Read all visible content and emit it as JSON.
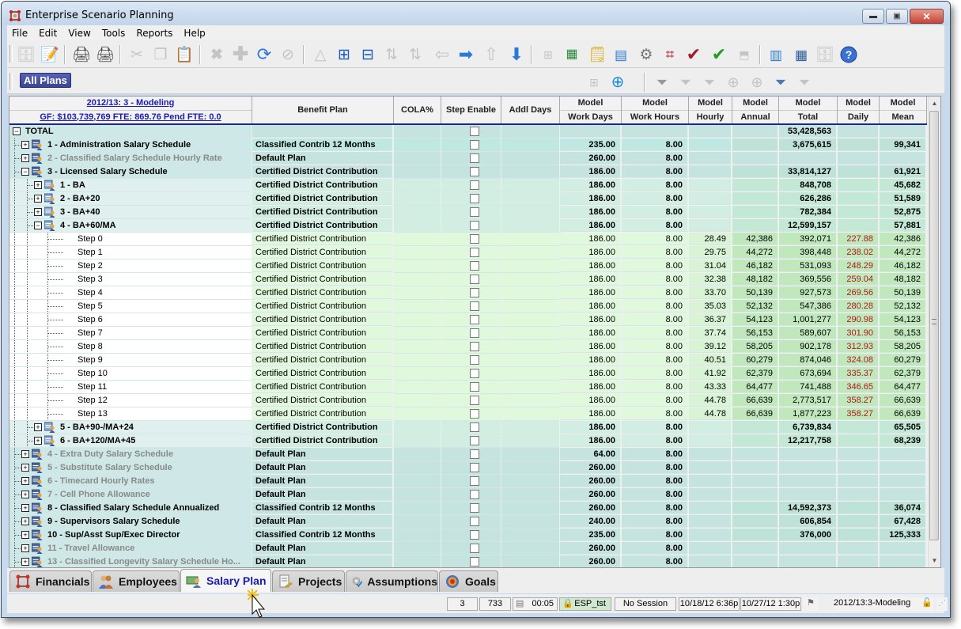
{
  "window": {
    "title": "Enterprise Scenario Planning",
    "controls": [
      "minimize",
      "maximize",
      "close"
    ]
  },
  "menu": [
    "File",
    "Edit",
    "View",
    "Tools",
    "Reports",
    "Help"
  ],
  "toolbar": {
    "main_icons": [
      "save-icon",
      "edit-icon",
      "print-icon",
      "print-preview-icon",
      "cut-icon",
      "copy-icon",
      "paste-icon",
      "delete-icon",
      "add-icon",
      "refresh-icon",
      "cancel-icon",
      "delta-icon",
      "expand-icon",
      "collapse-icon",
      "sort-asc-icon",
      "sort-desc-icon",
      "arrow-left-icon",
      "arrow-right-icon",
      "arrow-up-icon",
      "arrow-down-icon",
      "calculator-icon",
      "export-excel-icon",
      "add-note-icon",
      "grid-view-icon",
      "settings-window-icon",
      "model-window-icon",
      "check-red-icon",
      "check-green-icon",
      "upload-icon",
      "column-chooser-icon",
      "find-table-icon",
      "find-db-icon",
      "help-icon"
    ],
    "secondary_icons": [
      "calculator-icon",
      "target-icon",
      "filter-new-icon",
      "filter-edit-icon",
      "filter-remove-icon",
      "target-disabled-icon",
      "target-disabled2-icon",
      "filter-refresh-icon",
      "filter-save-icon"
    ],
    "all_plans_label": "All Plans"
  },
  "grid": {
    "header": {
      "scenario_link": "2012/13: 3 - Modeling",
      "summary_link": "GF: $103,739,769  FTE: 869.76  Pend FTE: 0.0",
      "columns": [
        {
          "l1": "",
          "l2": "Benefit Plan"
        },
        {
          "l1": "",
          "l2": "COLA%"
        },
        {
          "l1": "",
          "l2": "Step Enable"
        },
        {
          "l1": "",
          "l2": "Addl Days"
        },
        {
          "l1": "Model",
          "l2": "Work Days"
        },
        {
          "l1": "Model",
          "l2": "Work Hours"
        },
        {
          "l1": "Model",
          "l2": "Hourly"
        },
        {
          "l1": "Model",
          "l2": "Annual"
        },
        {
          "l1": "Model",
          "l2": "Total"
        },
        {
          "l1": "Model",
          "l2": "Daily"
        },
        {
          "l1": "Model",
          "l2": "Mean"
        }
      ]
    },
    "rows": [
      {
        "level": 0,
        "expander": "minus",
        "name": "TOTAL",
        "style": "bold",
        "plan": "",
        "work_days": "",
        "work_hours": "",
        "hourly": "",
        "annual": "",
        "total": "53,428,563",
        "daily": "",
        "mean": ""
      },
      {
        "level": 1,
        "expander": "plus",
        "name": "1 - Administration Salary Schedule",
        "style": "bold",
        "plan": "Classified Contrib 12 Months",
        "work_days": "235.00",
        "work_hours": "8.00",
        "hourly": "",
        "annual": "",
        "total": "3,675,615",
        "daily": "",
        "mean": "99,341"
      },
      {
        "level": 1,
        "expander": "plus",
        "name": "2 - Classified Salary Schedule Hourly Rate",
        "style": "grey",
        "plan": "Default Plan",
        "work_days": "260.00",
        "work_hours": "8.00",
        "hourly": "",
        "annual": "",
        "total": "",
        "daily": "",
        "mean": ""
      },
      {
        "level": 1,
        "expander": "minus",
        "name": "3 - Licensed Salary Schedule",
        "style": "bold",
        "plan": "Certified District Contribution",
        "work_days": "186.00",
        "work_hours": "8.00",
        "hourly": "",
        "annual": "",
        "total": "33,814,127",
        "daily": "",
        "mean": "61,921"
      },
      {
        "level": 2,
        "expander": "plus",
        "name": "1 - BA",
        "style": "bold",
        "plan": "Certified District Contribution",
        "work_days": "186.00",
        "work_hours": "8.00",
        "hourly": "",
        "annual": "",
        "total": "848,708",
        "daily": "",
        "mean": "45,682"
      },
      {
        "level": 2,
        "expander": "plus",
        "name": "2 - BA+20",
        "style": "bold",
        "plan": "Certified District Contribution",
        "work_days": "186.00",
        "work_hours": "8.00",
        "hourly": "",
        "annual": "",
        "total": "626,286",
        "daily": "",
        "mean": "51,589"
      },
      {
        "level": 2,
        "expander": "plus",
        "name": "3 - BA+40",
        "style": "bold",
        "plan": "Certified District Contribution",
        "work_days": "186.00",
        "work_hours": "8.00",
        "hourly": "",
        "annual": "",
        "total": "782,384",
        "daily": "",
        "mean": "52,875"
      },
      {
        "level": 2,
        "expander": "minus",
        "name": "4 - BA+60/MA",
        "style": "bold",
        "plan": "Certified District Contribution",
        "work_days": "186.00",
        "work_hours": "8.00",
        "hourly": "",
        "annual": "",
        "total": "12,599,157",
        "daily": "",
        "mean": "57,881"
      },
      {
        "level": 3,
        "expander": "",
        "name": "Step 0",
        "style": "step",
        "plan": "Certified District Contribution",
        "work_days": "186.00",
        "work_hours": "8.00",
        "hourly": "28.49",
        "annual": "42,386",
        "total": "392,071",
        "daily": "227.88",
        "mean": "42,386"
      },
      {
        "level": 3,
        "expander": "",
        "name": "Step 1",
        "style": "step",
        "plan": "Certified District Contribution",
        "work_days": "186.00",
        "work_hours": "8.00",
        "hourly": "29.75",
        "annual": "44,272",
        "total": "398,448",
        "daily": "238.02",
        "mean": "44,272"
      },
      {
        "level": 3,
        "expander": "",
        "name": "Step 2",
        "style": "step",
        "plan": "Certified District Contribution",
        "work_days": "186.00",
        "work_hours": "8.00",
        "hourly": "31.04",
        "annual": "46,182",
        "total": "531,093",
        "daily": "248.29",
        "mean": "46,182"
      },
      {
        "level": 3,
        "expander": "",
        "name": "Step 3",
        "style": "step",
        "plan": "Certified District Contribution",
        "work_days": "186.00",
        "work_hours": "8.00",
        "hourly": "32.38",
        "annual": "48,182",
        "total": "369,556",
        "daily": "259.04",
        "mean": "48,182"
      },
      {
        "level": 3,
        "expander": "",
        "name": "Step 4",
        "style": "step",
        "plan": "Certified District Contribution",
        "work_days": "186.00",
        "work_hours": "8.00",
        "hourly": "33.70",
        "annual": "50,139",
        "total": "927,573",
        "daily": "269.56",
        "mean": "50,139"
      },
      {
        "level": 3,
        "expander": "",
        "name": "Step 5",
        "style": "step",
        "plan": "Certified District Contribution",
        "work_days": "186.00",
        "work_hours": "8.00",
        "hourly": "35.03",
        "annual": "52,132",
        "total": "547,386",
        "daily": "280.28",
        "mean": "52,132"
      },
      {
        "level": 3,
        "expander": "",
        "name": "Step 6",
        "style": "step",
        "plan": "Certified District Contribution",
        "work_days": "186.00",
        "work_hours": "8.00",
        "hourly": "36.37",
        "annual": "54,123",
        "total": "1,001,277",
        "daily": "290.98",
        "mean": "54,123"
      },
      {
        "level": 3,
        "expander": "",
        "name": "Step 7",
        "style": "step",
        "plan": "Certified District Contribution",
        "work_days": "186.00",
        "work_hours": "8.00",
        "hourly": "37.74",
        "annual": "56,153",
        "total": "589,607",
        "daily": "301.90",
        "mean": "56,153"
      },
      {
        "level": 3,
        "expander": "",
        "name": "Step 8",
        "style": "step",
        "plan": "Certified District Contribution",
        "work_days": "186.00",
        "work_hours": "8.00",
        "hourly": "39.12",
        "annual": "58,205",
        "total": "902,178",
        "daily": "312.93",
        "mean": "58,205"
      },
      {
        "level": 3,
        "expander": "",
        "name": "Step 9",
        "style": "step",
        "plan": "Certified District Contribution",
        "work_days": "186.00",
        "work_hours": "8.00",
        "hourly": "40.51",
        "annual": "60,279",
        "total": "874,046",
        "daily": "324.08",
        "mean": "60,279"
      },
      {
        "level": 3,
        "expander": "",
        "name": "Step 10",
        "style": "step",
        "plan": "Certified District Contribution",
        "work_days": "186.00",
        "work_hours": "8.00",
        "hourly": "41.92",
        "annual": "62,379",
        "total": "673,694",
        "daily": "335.37",
        "mean": "62,379"
      },
      {
        "level": 3,
        "expander": "",
        "name": "Step 11",
        "style": "step",
        "plan": "Certified District Contribution",
        "work_days": "186.00",
        "work_hours": "8.00",
        "hourly": "43.33",
        "annual": "64,477",
        "total": "741,488",
        "daily": "346.65",
        "mean": "64,477"
      },
      {
        "level": 3,
        "expander": "",
        "name": "Step 12",
        "style": "step",
        "plan": "Certified District Contribution",
        "work_days": "186.00",
        "work_hours": "8.00",
        "hourly": "44.78",
        "annual": "66,639",
        "total": "2,773,517",
        "daily": "358.27",
        "mean": "66,639"
      },
      {
        "level": 3,
        "expander": "",
        "name": "Step 13",
        "style": "step",
        "plan": "Certified District Contribution",
        "work_days": "186.00",
        "work_hours": "8.00",
        "hourly": "44.78",
        "annual": "66,639",
        "total": "1,877,223",
        "daily": "358.27",
        "mean": "66,639"
      },
      {
        "level": 2,
        "expander": "plus",
        "name": "5 - BA+90-/MA+24",
        "style": "bold",
        "plan": "Certified District Contribution",
        "work_days": "186.00",
        "work_hours": "8.00",
        "hourly": "",
        "annual": "",
        "total": "6,739,834",
        "daily": "",
        "mean": "65,505"
      },
      {
        "level": 2,
        "expander": "plus",
        "name": "6 - BA+120/MA+45",
        "style": "bold",
        "plan": "Certified District Contribution",
        "work_days": "186.00",
        "work_hours": "8.00",
        "hourly": "",
        "annual": "",
        "total": "12,217,758",
        "daily": "",
        "mean": "68,239"
      },
      {
        "level": 1,
        "expander": "plus",
        "name": "4 - Extra Duty Salary Schedule",
        "style": "grey",
        "plan": "Default Plan",
        "work_days": "64.00",
        "work_hours": "8.00",
        "hourly": "",
        "annual": "",
        "total": "",
        "daily": "",
        "mean": ""
      },
      {
        "level": 1,
        "expander": "plus",
        "name": "5 - Substitute  Salary Schedule",
        "style": "grey",
        "plan": "Default Plan",
        "work_days": "260.00",
        "work_hours": "8.00",
        "hourly": "",
        "annual": "",
        "total": "",
        "daily": "",
        "mean": ""
      },
      {
        "level": 1,
        "expander": "plus",
        "name": "6 - Timecard Hourly Rates",
        "style": "grey",
        "plan": "Default Plan",
        "work_days": "260.00",
        "work_hours": "8.00",
        "hourly": "",
        "annual": "",
        "total": "",
        "daily": "",
        "mean": ""
      },
      {
        "level": 1,
        "expander": "plus",
        "name": "7 - Cell Phone Allowance",
        "style": "grey",
        "plan": "Default Plan",
        "work_days": "260.00",
        "work_hours": "8.00",
        "hourly": "",
        "annual": "",
        "total": "",
        "daily": "",
        "mean": ""
      },
      {
        "level": 1,
        "expander": "plus",
        "name": "8 - Classified Salary Schedule Annualized",
        "style": "bold",
        "plan": "Classified Contrib 12 Months",
        "work_days": "260.00",
        "work_hours": "8.00",
        "hourly": "",
        "annual": "",
        "total": "14,592,373",
        "daily": "",
        "mean": "36,074"
      },
      {
        "level": 1,
        "expander": "plus",
        "name": "9 - Supervisors Salary Schedule",
        "style": "bold",
        "plan": "Default Plan",
        "work_days": "240.00",
        "work_hours": "8.00",
        "hourly": "",
        "annual": "",
        "total": "606,854",
        "daily": "",
        "mean": "67,428"
      },
      {
        "level": 1,
        "expander": "plus",
        "name": "10 - Sup/Asst Sup/Exec Director",
        "style": "bold",
        "plan": "Classified Contrib 12 Months",
        "work_days": "235.00",
        "work_hours": "8.00",
        "hourly": "",
        "annual": "",
        "total": "376,000",
        "daily": "",
        "mean": "125,333"
      },
      {
        "level": 1,
        "expander": "plus",
        "name": "11 - Travel Allowance",
        "style": "grey",
        "plan": "Default Plan",
        "work_days": "260.00",
        "work_hours": "8.00",
        "hourly": "",
        "annual": "",
        "total": "",
        "daily": "",
        "mean": ""
      },
      {
        "level": 1,
        "expander": "plus",
        "name": "13 - Classified Longevity Salary Schedule Ho...",
        "style": "grey",
        "plan": "Default Plan",
        "work_days": "260.00",
        "work_hours": "8.00",
        "hourly": "",
        "annual": "",
        "total": "",
        "daily": "",
        "mean": ""
      }
    ]
  },
  "tabs": [
    {
      "label": "Financials",
      "icon": "financials-icon",
      "active": false
    },
    {
      "label": "Employees",
      "icon": "employees-icon",
      "active": false
    },
    {
      "label": "Salary Plan",
      "icon": "salary-plan-icon",
      "active": true
    },
    {
      "label": "Projects",
      "icon": "projects-icon",
      "active": false
    },
    {
      "label": "Assumptions",
      "icon": "assumptions-icon",
      "active": false
    },
    {
      "label": "Goals",
      "icon": "goals-icon",
      "active": false
    }
  ],
  "status": {
    "count1": "3",
    "count2": "733",
    "timer": "00:05",
    "database": "ESP_tst",
    "session": "No Session",
    "date1": "10/18/12 6:36p",
    "date2": "10/27/12 1:30p",
    "scenario": "2012/13:3-Modeling"
  },
  "colors": {
    "accent_link": "#1a1ab8",
    "all_plans_bg": "#3b4596",
    "daily_red": "#b01818",
    "row_teal": "#c9e6e2",
    "row_green": "#dff6dc",
    "status_db_bg": "#cfe8cf"
  }
}
